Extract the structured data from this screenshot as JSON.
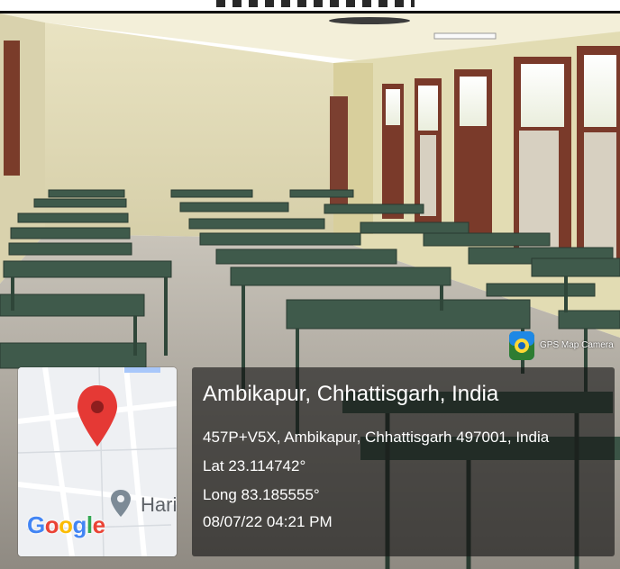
{
  "photo": {
    "scene": "classroom-with-green-desks"
  },
  "map": {
    "provider_logo": [
      "G",
      "o",
      "o",
      "g",
      "l",
      "e"
    ],
    "place_label": "Hari"
  },
  "overlay": {
    "app_name": "GPS Map Camera",
    "location_title": "Ambikapur, Chhattisgarh, India",
    "address": "457P+V5X, Ambikapur, Chhattisgarh 497001, India",
    "latitude": "Lat 23.114742°",
    "longitude": "Long 83.185555°",
    "datetime": "08/07/22 04:21 PM"
  },
  "colors": {
    "wall": "#e6dfb8",
    "floor": "#bdb6ab",
    "desk": "#3f5a4b",
    "map_pin": "#e53935",
    "accent": "#1e88e5"
  }
}
